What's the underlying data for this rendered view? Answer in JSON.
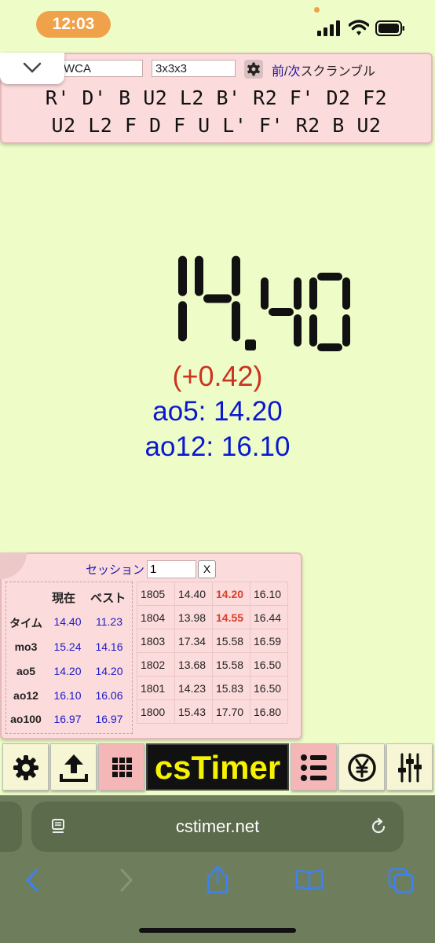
{
  "status_bar": {
    "time": "12:03"
  },
  "scramble": {
    "puzzle_group": "WCA",
    "puzzle_type": "3x3x3",
    "prev_label": "前",
    "separator": "/",
    "next_label": "次",
    "suffix_label": "スクランブル",
    "line1": "R' D' B U2 L2 B' R2 F' D2 F2",
    "line2": "U2 L2 F D F U L' F' R2 B U2"
  },
  "timer": {
    "display": "14.40",
    "delta": "(+0.42)",
    "ao5": "ao5: 14.20",
    "ao12": "ao12: 16.10"
  },
  "stats": {
    "session_label": "セッション",
    "session_value": "1",
    "session_clear": "X",
    "headers": {
      "current": "現在",
      "best": "ベスト"
    },
    "rows": [
      {
        "label": "タイム",
        "current": "14.40",
        "best": "11.23"
      },
      {
        "label": "mo3",
        "current": "15.24",
        "best": "14.16"
      },
      {
        "label": "ao5",
        "current": "14.20",
        "best": "14.20"
      },
      {
        "label": "ao12",
        "current": "16.10",
        "best": "16.06"
      },
      {
        "label": "ao100",
        "current": "16.97",
        "best": "16.97"
      }
    ],
    "history": [
      [
        "1805",
        "14.40",
        "14.20",
        "16.10"
      ],
      [
        "1804",
        "13.98",
        "14.55",
        "16.44"
      ],
      [
        "1803",
        "17.34",
        "15.58",
        "16.59"
      ],
      [
        "1802",
        "13.68",
        "15.58",
        "16.50"
      ],
      [
        "1801",
        "14.23",
        "15.83",
        "16.50"
      ],
      [
        "1800",
        "15.43",
        "17.70",
        "16.80"
      ]
    ]
  },
  "toolbar": {
    "logo": "csTimer",
    "buttons": [
      "gear-icon",
      "export-icon",
      "grid-icon",
      "list-icon",
      "yen-icon",
      "sliders-icon"
    ]
  },
  "browser": {
    "url": "cstimer.net"
  },
  "colors": {
    "background": "#eefcc8",
    "panel": "#fcdbdc",
    "accent_blue": "#0a18d0",
    "delta_red": "#cc3322",
    "logo_yellow": "#f7f200"
  }
}
